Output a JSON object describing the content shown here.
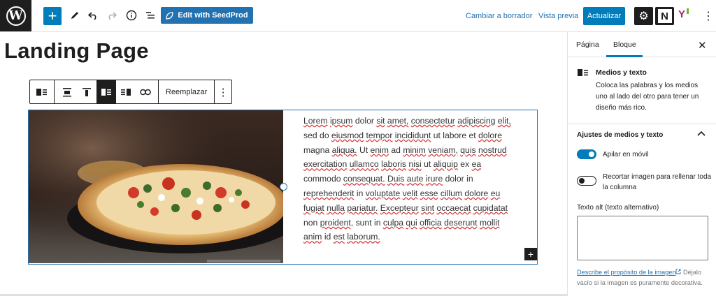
{
  "topbar": {
    "logo_letter": "W",
    "seedprod_label": "Edit with SeedProd",
    "switch_draft": "Cambiar a borrador",
    "preview": "Vista previa",
    "update": "Actualizar",
    "n_plugin_letter": "N",
    "yoast_letter": "Y"
  },
  "editor": {
    "page_title": "Landing Page",
    "toolbar_replace": "Reemplazar",
    "paragraph_words": [
      "Lorem",
      "ipsum",
      "dolor",
      "sit",
      "amet,",
      "consectetur",
      "adipiscing",
      "elit,",
      "sed",
      "do",
      "eiusmod",
      "tempor",
      "incididunt",
      "ut",
      "labore",
      "et",
      "dolore",
      "magna",
      "aliqua.",
      "Ut",
      "enim",
      "ad",
      "minim",
      "veniam,",
      "quis",
      "nostrud",
      "exercitation",
      "ullamco",
      "laboris",
      "nisi",
      "ut",
      "aliquip",
      "ex",
      "ea",
      "commodo",
      "consequat.",
      "Duis",
      "aute",
      "irure",
      "dolor",
      "in",
      "reprehenderit",
      "in",
      "voluptate",
      "velit",
      "esse",
      "cillum",
      "dolore",
      "eu",
      "fugiat",
      "nulla",
      "pariatur.",
      "Excepteur",
      "sint",
      "occaecat",
      "cupidatat",
      "non",
      "proident,",
      "sunt",
      "in",
      "culpa",
      "qui",
      "officia",
      "deserunt",
      "mollit",
      "anim",
      "id",
      "est",
      "laborum."
    ],
    "misspelled": [
      "Lorem",
      "ipsum",
      "sit",
      "amet,",
      "consectetur",
      "adipiscing",
      "elit,",
      "eiusmod",
      "tempor",
      "incididunt",
      "dolore",
      "aliqua.",
      "enim",
      "minim",
      "veniam,",
      "quis",
      "nostrud",
      "exercitation",
      "ullamco",
      "laboris",
      "nisi",
      "aliquip",
      "ea",
      "consequat.",
      "Duis",
      "aute",
      "irure",
      "reprehenderit",
      "voluptate",
      "velit",
      "esse",
      "cillum",
      "eu",
      "fugiat",
      "nulla",
      "pariatur.",
      "Excepteur",
      "sint",
      "occaecat",
      "cupidatat",
      "proident,",
      "culpa",
      "qui",
      "officia",
      "deserunt",
      "mollit",
      "anim",
      "est",
      "laborum."
    ]
  },
  "sidebar": {
    "tab_page": "Página",
    "tab_block": "Bloque",
    "close_glyph": "✕",
    "block_name": "Medios y texto",
    "block_desc": "Coloca las palabras y los medios uno al lado del otro para tener un diseño más rico.",
    "panel_title": "Ajustes de medios y texto",
    "stack_mobile": "Apilar en móvil",
    "stack_mobile_on": true,
    "crop_image": "Recortar imagen para rellenar toda la columna",
    "crop_image_on": false,
    "alt_label": "Texto alt (texto alternativo)",
    "alt_value": "",
    "alt_help_link": "Describe el propósito de la imagen",
    "alt_help_rest": "Déjalo vacío si la imagen es puramente decorativa."
  },
  "colors": {
    "accent": "#007cba",
    "dark": "#1e1e1e",
    "link": "#2271b1"
  }
}
